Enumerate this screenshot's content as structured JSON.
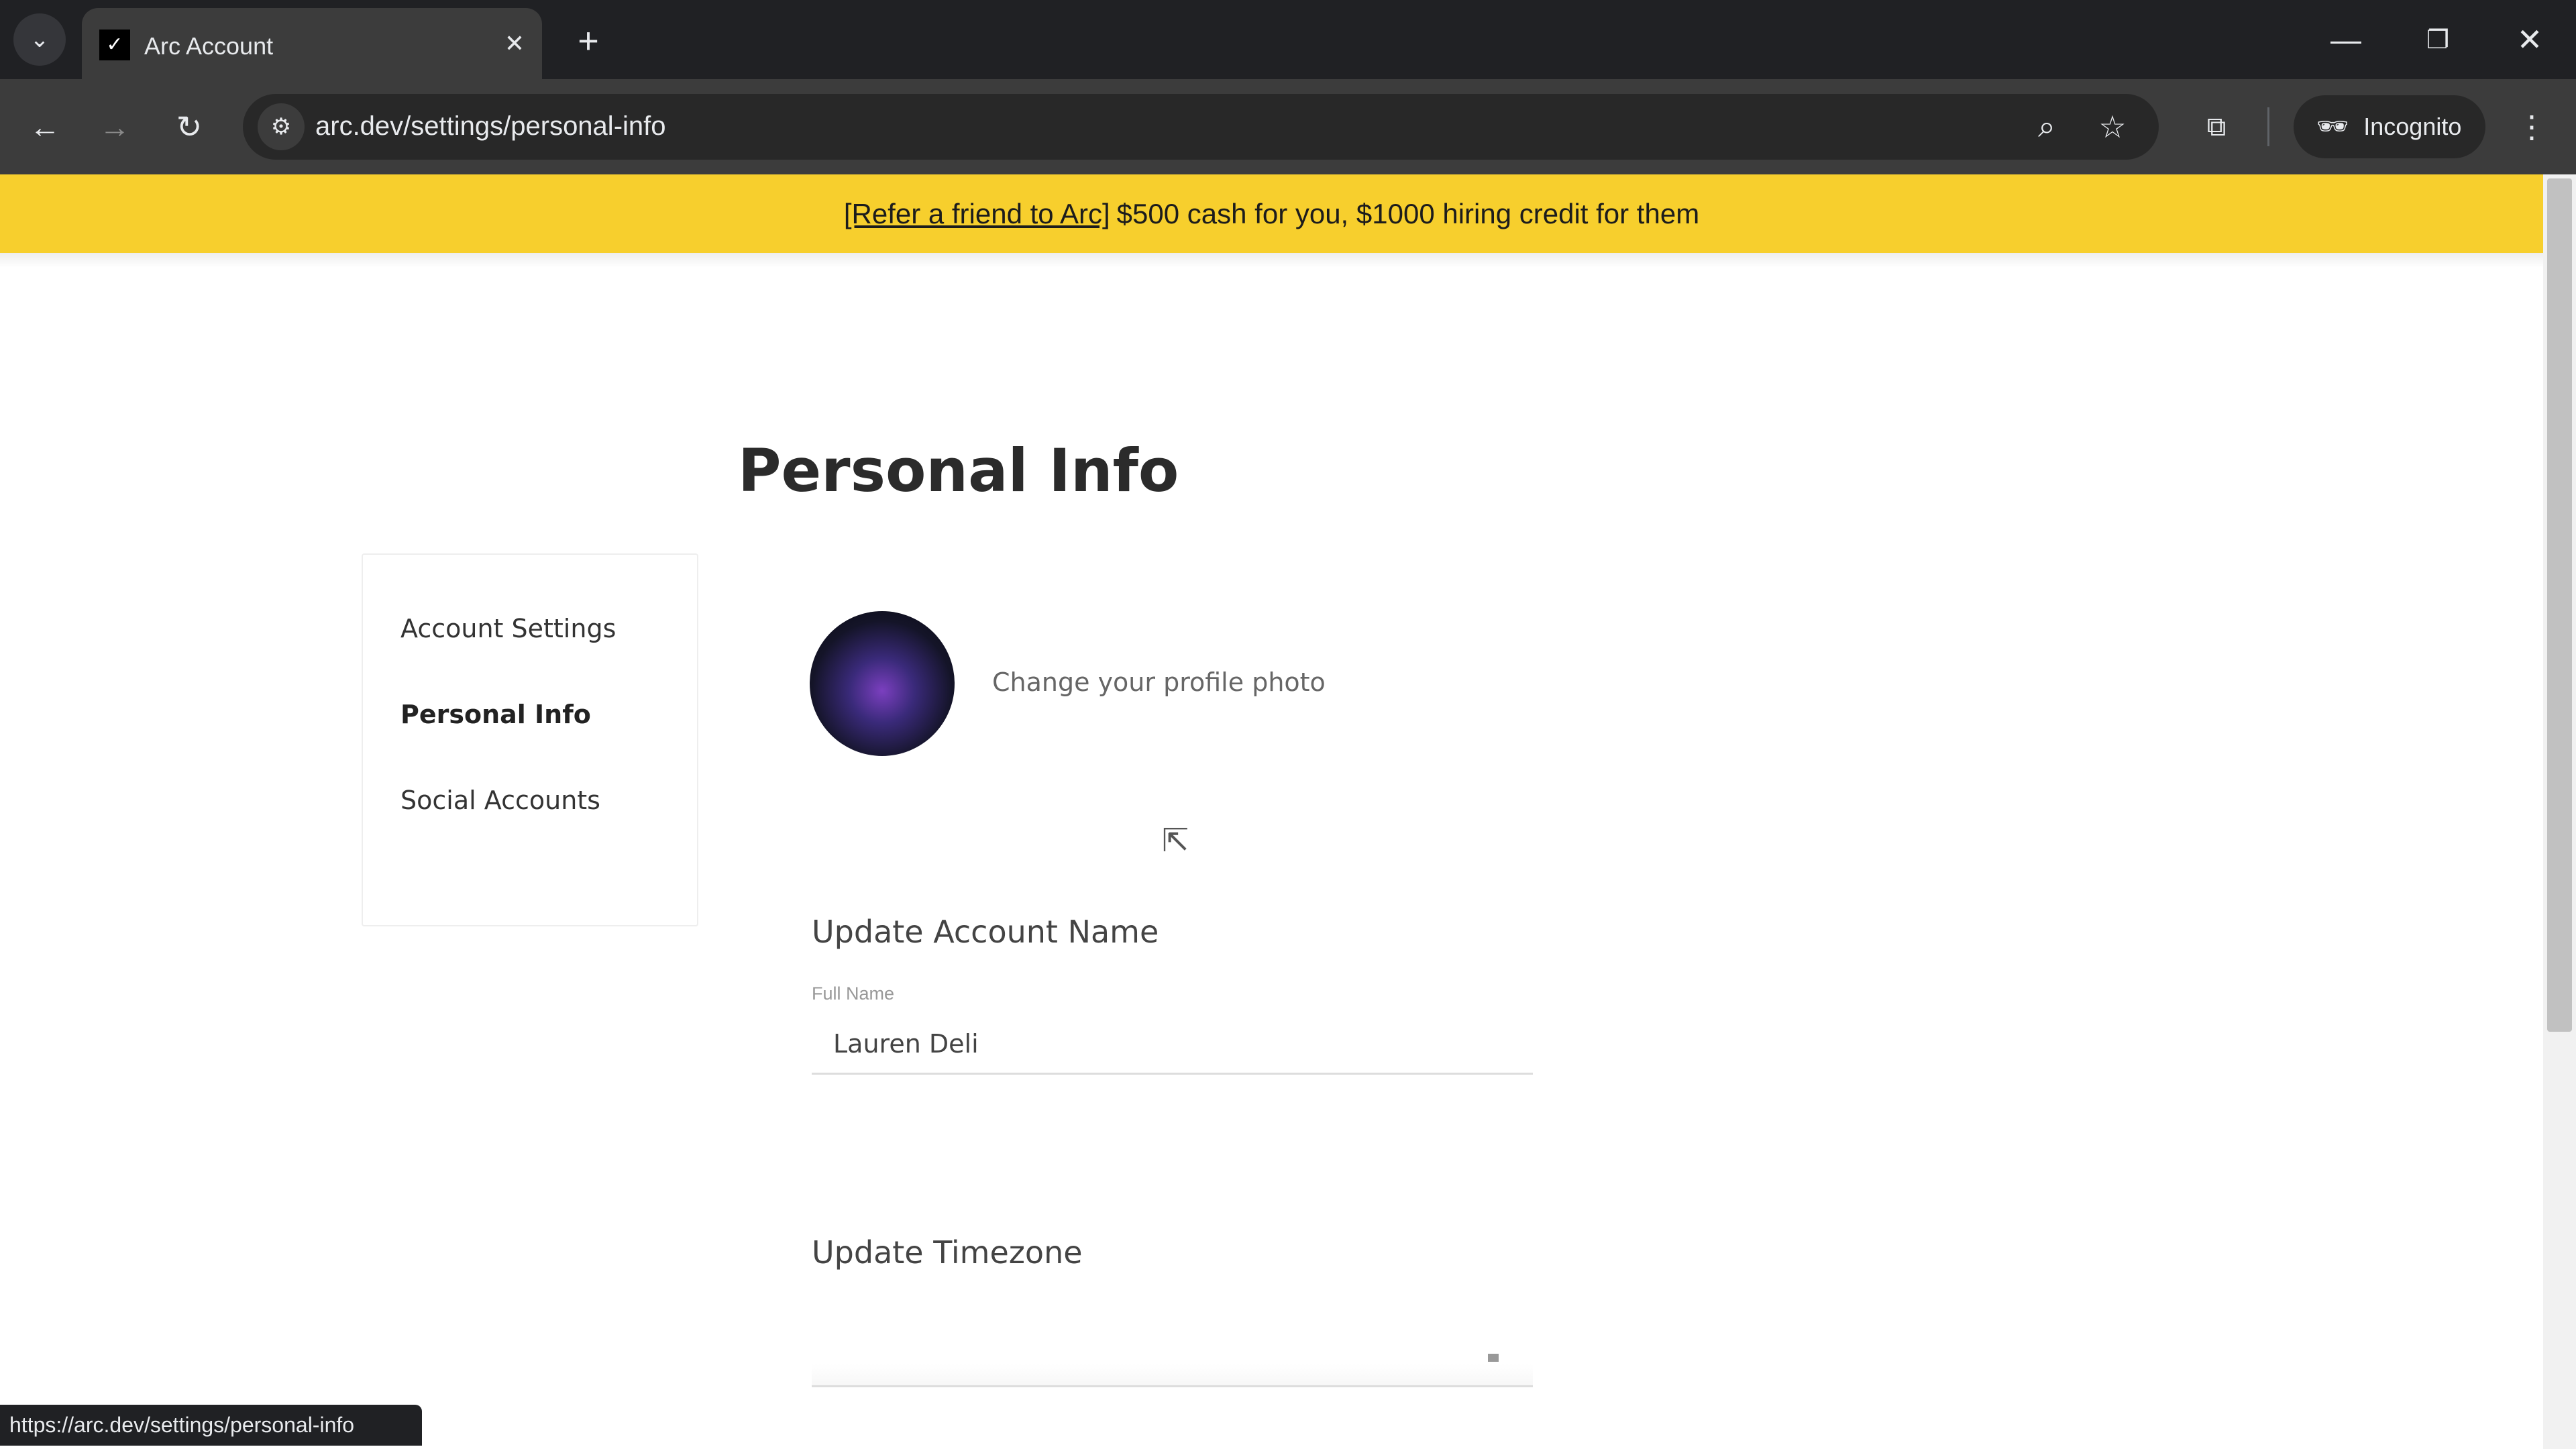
{
  "browser": {
    "tab_title": "Arc Account",
    "url": "arc.dev/settings/personal-info",
    "incognito_label": "Incognito",
    "status_url": "https://arc.dev/settings/personal-info"
  },
  "banner": {
    "link": "[Refer a friend to Arc]",
    "text": "$500 cash for you, $1000 hiring credit for them",
    "color": "#f7cf2d"
  },
  "page": {
    "title": "Personal Info",
    "sidebar": {
      "items": [
        {
          "label": "Account Settings"
        },
        {
          "label": "Personal Info",
          "active": true
        },
        {
          "label": "Social Accounts"
        }
      ]
    },
    "photo": {
      "label": "Change your profile photo"
    },
    "account_name": {
      "heading": "Update Account Name",
      "field_label": "Full Name",
      "value": "Lauren Deli"
    },
    "timezone": {
      "heading": "Update Timezone",
      "value": ""
    }
  }
}
